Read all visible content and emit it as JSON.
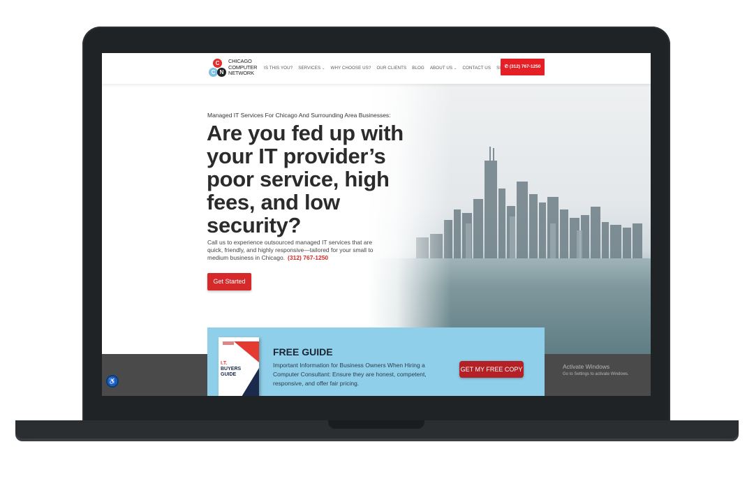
{
  "header": {
    "logo_letters": [
      "C",
      "C",
      "N"
    ],
    "logo_lines": [
      "CHICAGO",
      "COMPUTER",
      "NETWORK"
    ],
    "nav": [
      {
        "label": "IS THIS YOU?",
        "dropdown": false
      },
      {
        "label": "SERVICES",
        "dropdown": true
      },
      {
        "label": "WHY CHOOSE US?",
        "dropdown": false
      },
      {
        "label": "OUR CLIENTS",
        "dropdown": false
      },
      {
        "label": "BLOG",
        "dropdown": false
      },
      {
        "label": "ABOUT US",
        "dropdown": true
      },
      {
        "label": "CONTACT US",
        "dropdown": false
      },
      {
        "label": "SUPPORT",
        "dropdown": false
      }
    ],
    "phone_button": "(312) 767-1250"
  },
  "hero": {
    "subtitle": "Managed IT Services For Chicago And Surrounding Area Businesses:",
    "title": "Are you fed up with your IT provider’s poor service, high fees, and low security?",
    "description": "Call us to experience outsourced managed IT services that are quick, friendly, and highly responsive—tailored for your small to medium business in Chicago.",
    "phone": "(312) 767-1250",
    "cta": "Get Started"
  },
  "guide": {
    "book_text": [
      "I.T.",
      "BUYERS",
      "GUIDE"
    ],
    "title": "FREE GUIDE",
    "description": "Important Information for Business Owners When Hiring a Computer Consultant: Ensure they are honest, competent, responsive, and offer fair pricing.",
    "button": "GET MY FREE COPY"
  },
  "windows_notice": {
    "line1": "Activate Windows",
    "line2": "Go to Settings to activate Windows."
  },
  "colors": {
    "brand_red": "#e42026",
    "guide_bg": "#8fcfe9",
    "dark_band": "#4a4a4a"
  },
  "icons": {
    "phone": "phone-icon",
    "accessibility": "accessibility-icon",
    "chevron": "chevron-down-icon"
  }
}
